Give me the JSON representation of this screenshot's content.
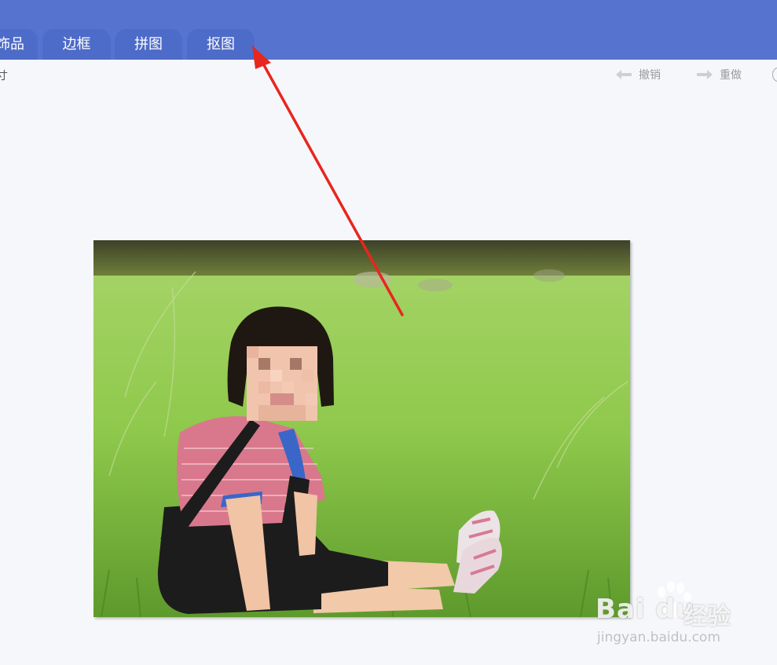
{
  "tabs": [
    {
      "label": "饰品"
    },
    {
      "label": "边框"
    },
    {
      "label": "拼图"
    },
    {
      "label": "抠图"
    }
  ],
  "toolbar": {
    "left_fragment": "寸",
    "undo_label": "撤销",
    "redo_label": "重做"
  },
  "watermark": {
    "brand": "Bai du",
    "cn_text": "经验",
    "url": "jingyan.baidu.com"
  },
  "colors": {
    "header": "#5674cf",
    "tab": "#4d6bc8",
    "canvas": "#f6f7fb",
    "annotation_arrow": "#e8261e"
  },
  "icons": {
    "undo": "arrow-left-icon",
    "redo": "arrow-right-icon"
  }
}
